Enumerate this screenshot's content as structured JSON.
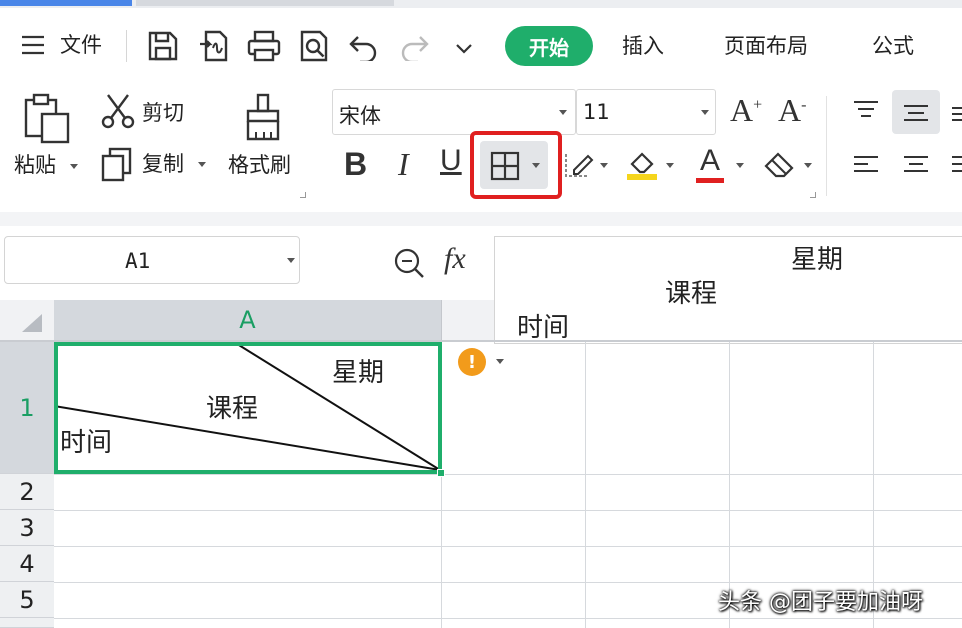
{
  "menu": {
    "file_label": "文件",
    "tabs": [
      {
        "label": "开始",
        "active": true
      },
      {
        "label": "插入"
      },
      {
        "label": "页面布局"
      },
      {
        "label": "公式"
      }
    ]
  },
  "ribbon": {
    "paste_label": "粘贴",
    "cut_label": "剪切",
    "copy_label": "复制",
    "format_painter_label": "格式刷",
    "font_name": "宋体",
    "font_size": "11",
    "bold": "B",
    "italic": "I",
    "underline": "U",
    "font_color": "A",
    "increase_font": "A",
    "decrease_font": "A",
    "superscript_plus": "+",
    "superscript_minus": "-"
  },
  "formula_bar": {
    "name_box": "A1",
    "fx": "fx",
    "content_line1": "星期",
    "content_line2": "课程",
    "content_line3": "时间"
  },
  "sheet": {
    "column_header": "A",
    "rows": [
      "1",
      "2",
      "3",
      "4",
      "5"
    ],
    "cell_a1": {
      "top_right": "星期",
      "middle": "课程",
      "bottom_left": "时间"
    },
    "warning_mark": "!"
  },
  "watermark": "头条 @团子要加油呀",
  "colors": {
    "accent": "#1fae6b",
    "highlight_box": "#e02020",
    "warning": "#f29b1b",
    "font_color_underline": "#e02020",
    "fill_color": "#f5d51c"
  }
}
